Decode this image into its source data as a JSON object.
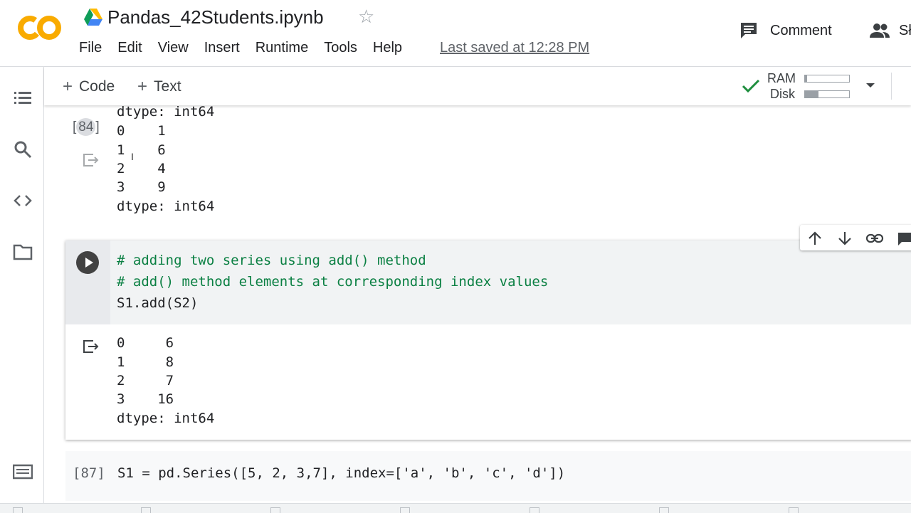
{
  "app": {
    "logo_text": "CO",
    "notebook_title": "Pandas_42Students.ipynb",
    "last_saved": "Last saved at 12:28 PM"
  },
  "menu": [
    "File",
    "Edit",
    "View",
    "Insert",
    "Runtime",
    "Tools",
    "Help"
  ],
  "header_actions": {
    "comment_label": "Comment",
    "share_label": "Sł"
  },
  "toolbar": {
    "add_code_label": "Code",
    "add_text_label": "Text",
    "ram_label": "RAM",
    "disk_label": "Disk",
    "ram_usage": 0.05,
    "disk_usage": 0.3
  },
  "sidebar": {
    "icons": [
      "table-of-contents-icon",
      "search-icon",
      "code-snippets-icon",
      "files-icon",
      "terminal-icon"
    ]
  },
  "previous_output": {
    "execution_count": "84",
    "lines": [
      "dtype: int64",
      "0    1",
      "1    6",
      "2    4",
      "3    9",
      "dtype: int64"
    ]
  },
  "active_cell": {
    "code_lines": [
      "# adding two series using add() method",
      "# add() method elements at corresponding index values",
      "S1.add(S2)"
    ],
    "output_lines": [
      "0     6",
      "1     8",
      "2     7",
      "3    16",
      "dtype: int64"
    ]
  },
  "next_cell": {
    "execution_label": "[87]",
    "code": "S1 = pd.Series([5, 2, 3,7], index=['a', 'b', 'c', 'd'])"
  },
  "colors": {
    "accent_orange": "#f9ab00",
    "check_green": "#1e8e3e",
    "comment_green": "#0b8043"
  }
}
